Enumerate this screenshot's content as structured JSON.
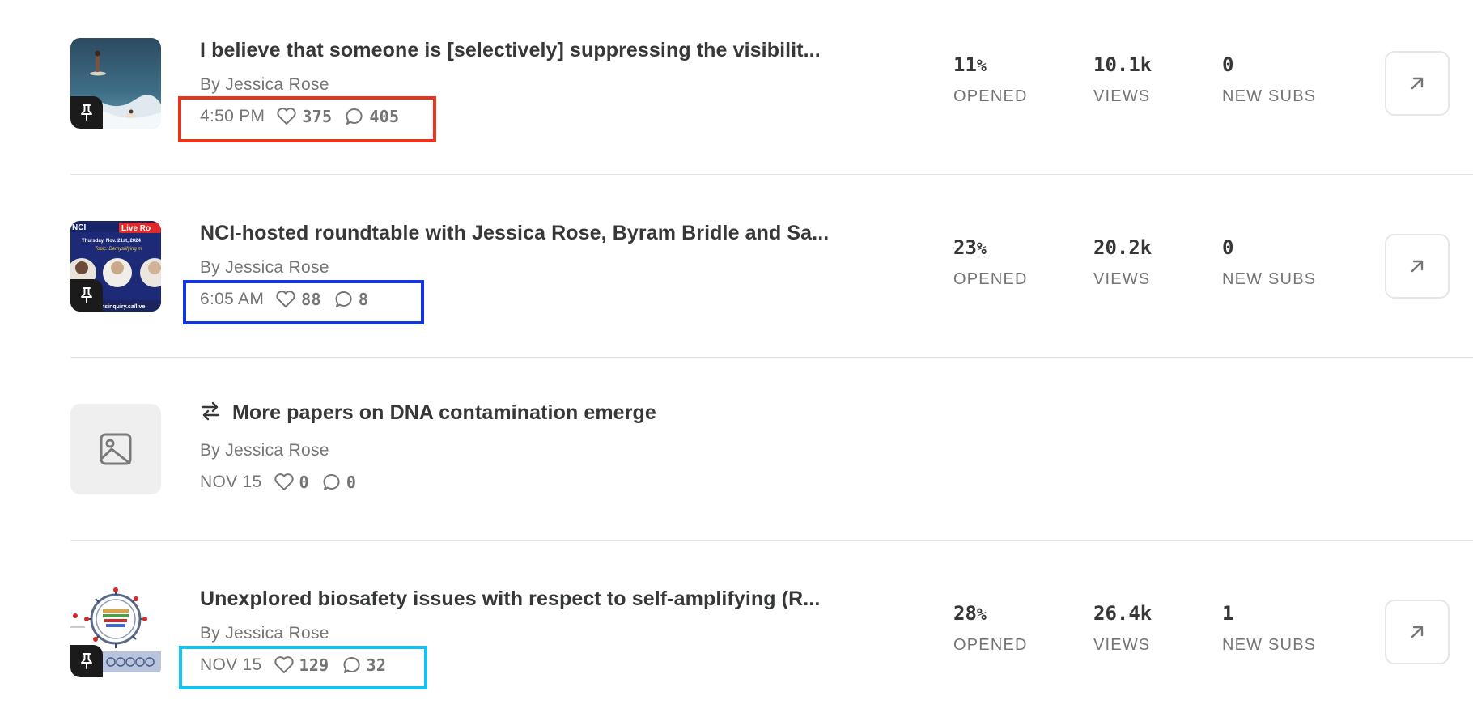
{
  "posts": [
    {
      "title": "I believe that someone is [selectively] suppressing the visibilit...",
      "byline": "By Jessica Rose",
      "time": "4:50 PM",
      "likes": "375",
      "comments": "405",
      "opened_value": "11",
      "opened_unit": "%",
      "opened_label": "OPENED",
      "views_value": "10.1k",
      "views_label": "VIEWS",
      "subs_value": "0",
      "subs_label": "NEW SUBS",
      "pinned": true,
      "thumbnail": "surfer-photo",
      "highlight_color": "#e8341c"
    },
    {
      "title": "NCI-hosted roundtable with Jessica Rose, Byram Bridle and Sa...",
      "byline": "By Jessica Rose",
      "time": "6:05 AM",
      "likes": "88",
      "comments": "8",
      "opened_value": "23",
      "opened_unit": "%",
      "opened_label": "OPENED",
      "views_value": "20.2k",
      "views_label": "VIEWS",
      "subs_value": "0",
      "subs_label": "NEW SUBS",
      "pinned": true,
      "thumbnail": "nci-live-banner",
      "thumb_text": {
        "brand": "NCI",
        "live": "Live Ro",
        "date": "Thursday, Nov. 21st, 2024",
        "topic": "Topic: Demystifying m",
        "url": "nsinquiry.ca/live"
      },
      "highlight_color": "#1235e0"
    },
    {
      "title": "More papers on DNA contamination emerge",
      "byline": "By Jessica Rose",
      "time": "NOV 15",
      "likes": "0",
      "comments": "0",
      "pinned": false,
      "restack": true,
      "thumbnail": "image-placeholder-icon"
    },
    {
      "title": "Unexplored biosafety issues with respect to self-amplifying (R...",
      "byline": "By Jessica Rose",
      "time": "NOV 15",
      "likes": "129",
      "comments": "32",
      "opened_value": "28",
      "opened_unit": "%",
      "opened_label": "OPENED",
      "views_value": "26.4k",
      "views_label": "VIEWS",
      "subs_value": "1",
      "subs_label": "NEW SUBS",
      "pinned": true,
      "thumbnail": "virus-diagram",
      "highlight_color": "#18c0ec"
    }
  ]
}
